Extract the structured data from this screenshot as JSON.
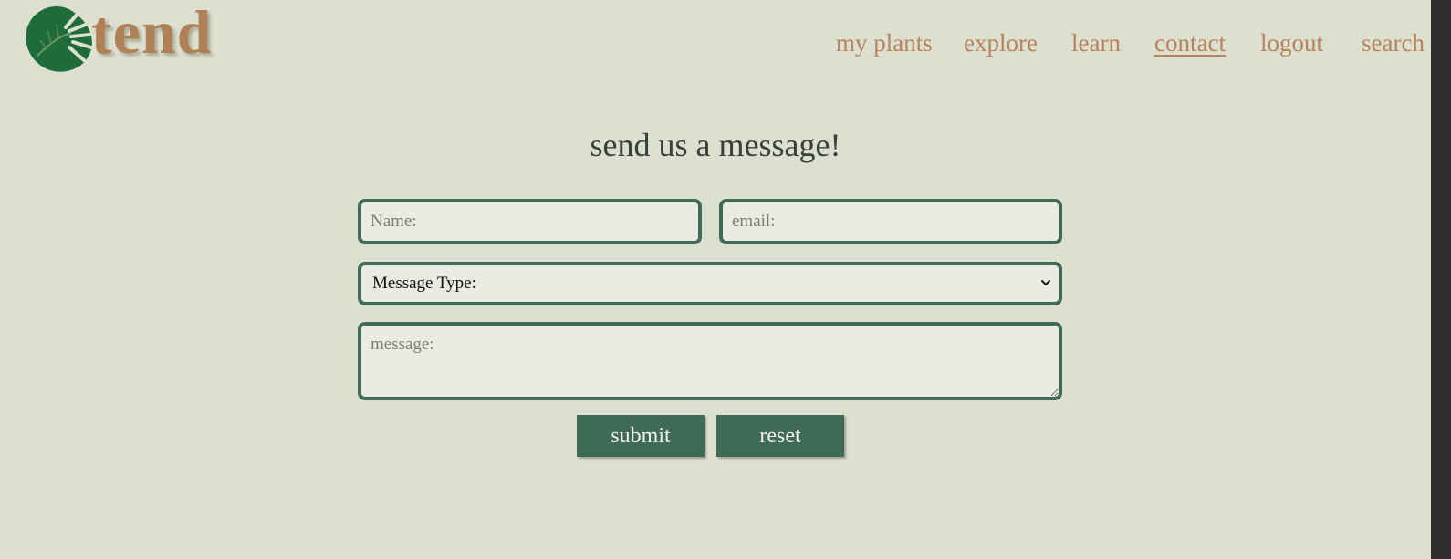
{
  "brand": {
    "logo_text": "tend",
    "logo_icon": "monstera-leaf-icon",
    "text_color": "#b08156",
    "leaf_color": "#1f6b3a"
  },
  "nav": {
    "items": [
      {
        "label": "my plants",
        "active": false
      },
      {
        "label": "explore",
        "active": false
      },
      {
        "label": "learn",
        "active": false
      },
      {
        "label": "contact",
        "active": true
      },
      {
        "label": "logout",
        "active": false
      },
      {
        "label": "search",
        "active": false
      }
    ],
    "color": "#b8825a"
  },
  "form": {
    "title": "send us a message!",
    "name_placeholder": "Name:",
    "email_placeholder": "email:",
    "type_selected": "Message Type:",
    "message_placeholder": "message:",
    "submit_label": "submit",
    "reset_label": "reset",
    "accent": "#3e6a56"
  }
}
